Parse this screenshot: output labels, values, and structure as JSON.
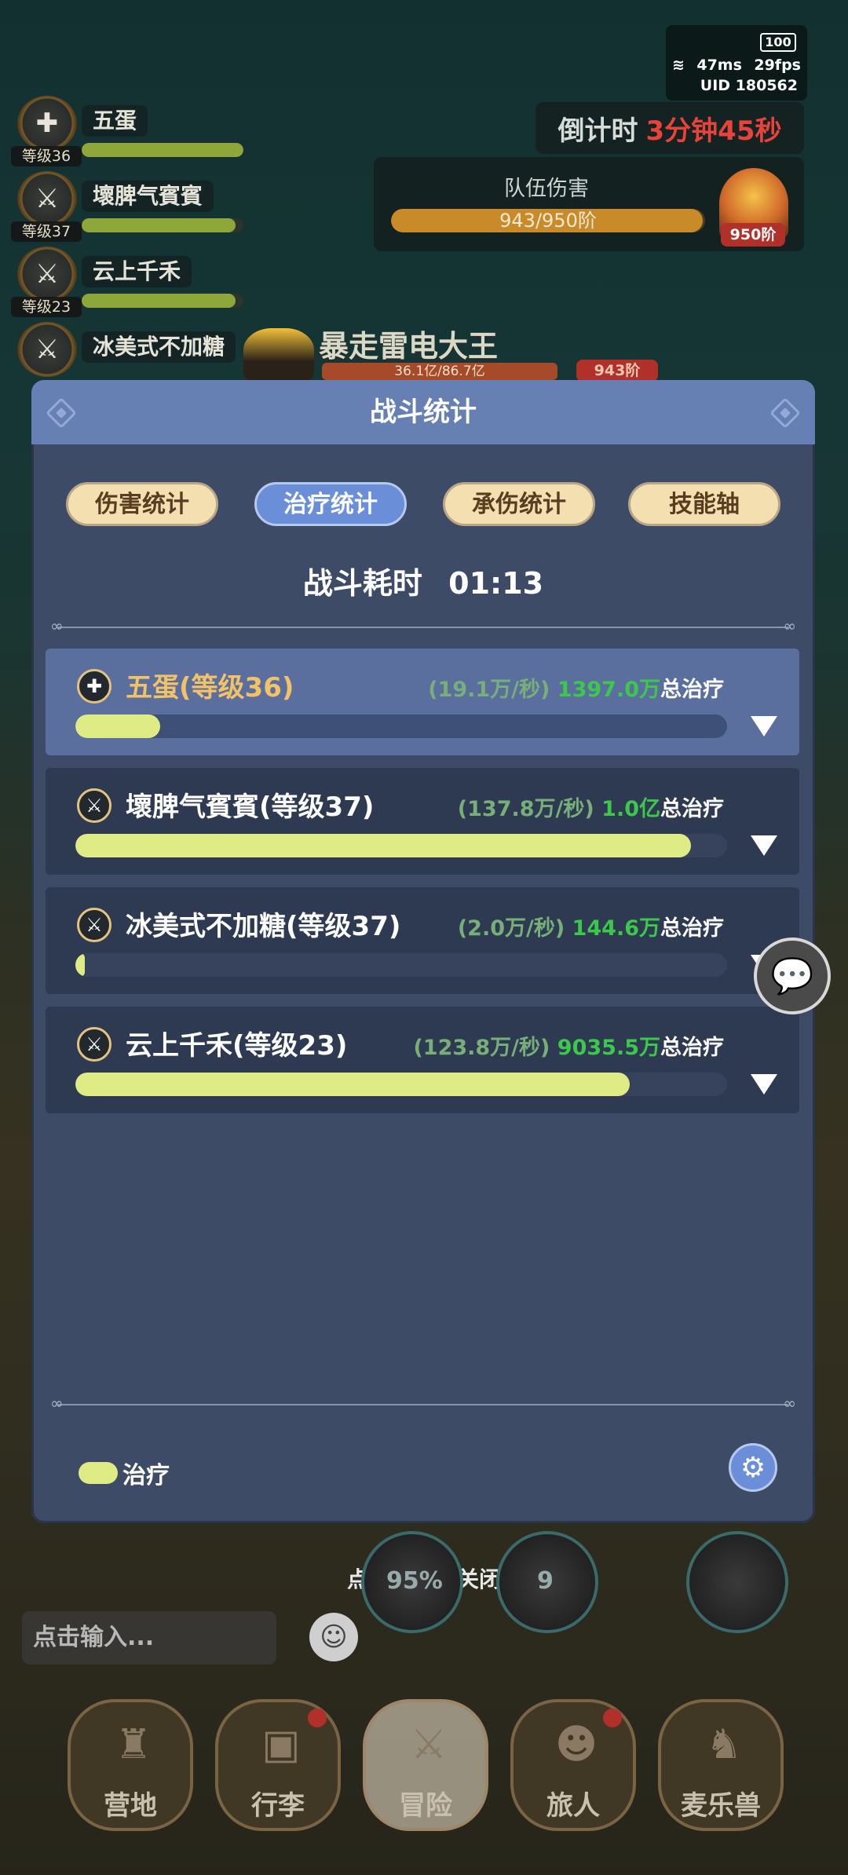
{
  "status": {
    "battery": "100",
    "ping": "47ms",
    "fps": "29fps",
    "uid": "UID  180562"
  },
  "countdown": {
    "label": "倒计时",
    "value": "3分钟45秒"
  },
  "team_damage": {
    "title": "队伍伤害",
    "progress_text": "943/950阶",
    "progress": 0.993,
    "tier_tag": "950阶"
  },
  "players": [
    {
      "name": "五蛋",
      "level": "等级36",
      "icon": "cross-medal-icon"
    },
    {
      "name": "壞脾气賓賓",
      "level": "等级37",
      "icon": "sword-medal-icon"
    },
    {
      "name": "云上千禾",
      "level": "等级23",
      "icon": "sword-medal-icon"
    },
    {
      "name": "冰美式不加糖",
      "level": "等级37",
      "icon": "sword-medal-icon"
    }
  ],
  "boss": {
    "name": "暴走雷电大王",
    "hp_text": "36.1亿/86.7亿",
    "tier": "943阶"
  },
  "modal": {
    "title": "战斗统计",
    "tabs": [
      {
        "label": "伤害统计",
        "active": false
      },
      {
        "label": "治疗统计",
        "active": true
      },
      {
        "label": "承伤统计",
        "active": false
      },
      {
        "label": "技能轴",
        "active": false
      }
    ],
    "duration_label": "战斗耗时",
    "duration_value": "01:13",
    "rows": [
      {
        "name": "五蛋(等级36)",
        "rate": "(19.1万/秒)",
        "total": "1397.0万",
        "suffix": "总治疗",
        "fill": 0.13,
        "highlight": true
      },
      {
        "name": "壞脾气賓賓(等级37)",
        "rate": "(137.8万/秒)",
        "total": "1.0亿",
        "suffix": "总治疗",
        "fill": 0.945,
        "highlight": false
      },
      {
        "name": "冰美式不加糖(等级37)",
        "rate": "(2.0万/秒)",
        "total": "144.6万",
        "suffix": "总治疗",
        "fill": 0.014,
        "highlight": false
      },
      {
        "name": "云上千禾(等级23)",
        "rate": "(123.8万/秒)",
        "total": "9035.5万",
        "suffix": "总治疗",
        "fill": 0.85,
        "highlight": false
      }
    ],
    "legend_label": "治疗"
  },
  "close_hint": "点击空白处关闭",
  "chat": {
    "placeholder": "点击输入..."
  },
  "skills": {
    "percent": "95%",
    "count": "9"
  },
  "nav": [
    {
      "label": "营地",
      "icon": "castle-icon",
      "badge": false
    },
    {
      "label": "行李",
      "icon": "chest-icon",
      "badge": true
    },
    {
      "label": "冒险",
      "icon": "crossed-swords-icon",
      "badge": false
    },
    {
      "label": "旅人",
      "icon": "traveler-icon",
      "badge": true
    },
    {
      "label": "麦乐兽",
      "icon": "beast-icon",
      "badge": false
    }
  ]
}
